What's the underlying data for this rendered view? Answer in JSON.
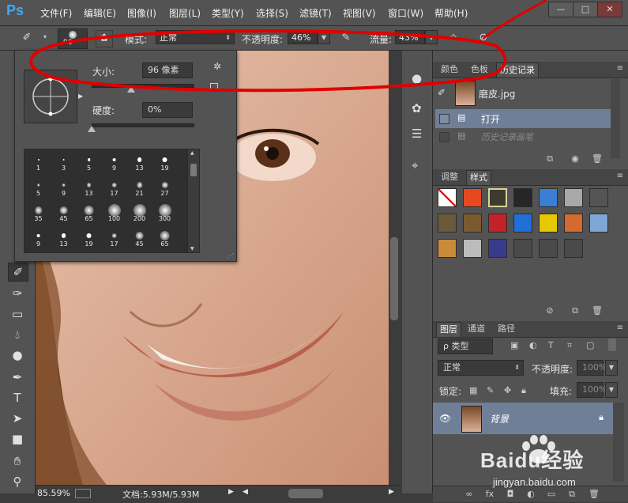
{
  "app": {
    "logo": "Ps"
  },
  "menu": [
    "文件(F)",
    "编辑(E)",
    "图像(I)",
    "图层(L)",
    "类型(Y)",
    "选择(S)",
    "滤镜(T)",
    "视图(V)",
    "窗口(W)",
    "帮助(H)"
  ],
  "window_buttons": [
    "—",
    "□",
    "✕"
  ],
  "options": {
    "brush_size_label": "96",
    "mode_label": "模式:",
    "mode_value": "正常",
    "opacity_label": "不透明度:",
    "opacity_value": "46%",
    "flow_label": "流量:",
    "flow_value": "43%"
  },
  "brush_picker": {
    "size_label": "大小:",
    "size_value": "96 像素",
    "hardness_label": "硬度:",
    "hardness_value": "0%",
    "size_level": 0.39,
    "hardness_level": 0.0,
    "presets": [
      [
        "1",
        "3",
        "5",
        "9",
        "13",
        "19"
      ],
      [
        "5",
        "9",
        "13",
        "17",
        "21",
        "27"
      ],
      [
        "35",
        "45",
        "65",
        "100",
        "200",
        "300"
      ],
      [
        "9",
        "13",
        "19",
        "17",
        "45",
        "65"
      ]
    ]
  },
  "panels": {
    "history": {
      "tabs": [
        "颜色",
        "色板",
        "历史记录"
      ],
      "snapshot_name": "磨皮.jpg",
      "states": [
        {
          "label": "打开"
        },
        {
          "label": "历史记录画笔"
        }
      ]
    },
    "styles": {
      "tabs": [
        "调整",
        "样式"
      ],
      "swatch_colors": [
        [
          "#ffffff",
          "#e8481f",
          "#3d3b2e",
          "#262626",
          "#3b7fd4",
          "#a8a8a8",
          "#545454"
        ],
        [
          "#6b5a3a",
          "#7a5a2e",
          "#c4222a",
          "#1f6fd6",
          "#e6c700",
          "#d46a2e",
          "#7fa6d6"
        ],
        [
          "#c98a3a",
          "#bcbcbc",
          "#3a3a8c",
          "#4a4a4a",
          "#4a4a4a",
          "#4a4a4a"
        ]
      ]
    },
    "layers": {
      "tabs": [
        "图层",
        "通道",
        "路径"
      ],
      "filter_label": "ρ 类型",
      "blend_mode": "正常",
      "opacity_label": "不透明度:",
      "opacity_value": "100%",
      "lock_label": "锁定:",
      "fill_label": "填充:",
      "fill_value": "100%",
      "layer_name": "背景"
    }
  },
  "status": {
    "zoom": "85.59%",
    "doc": "文档:5.93M/5.93M"
  },
  "watermark": {
    "text": "Baidu经验",
    "url": "jingyan.baidu.com"
  },
  "colors": {
    "ui_dark": "#535353",
    "ui_darker": "#3c3c3c",
    "annotation_red": "#e00000",
    "history_selected": "#6f7f97",
    "layer_selected": "#6f7f97"
  }
}
